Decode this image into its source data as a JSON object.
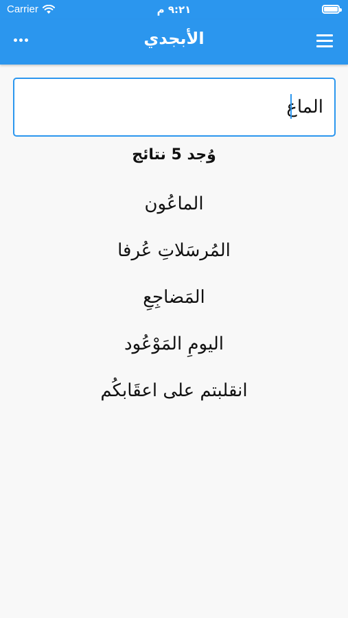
{
  "status_bar": {
    "carrier": "Carrier",
    "time": "٩:٢١ م"
  },
  "nav": {
    "title": "الأبجدي"
  },
  "search": {
    "value": "الماع"
  },
  "results_count": "وُجد 5 نتائج",
  "results": [
    "الماعُون",
    "المُرسَلاتِ عُرفا",
    "المَضاجِعِ",
    "اليومِ المَوْعُود",
    "انقلبتم على اعقَابكُم"
  ]
}
